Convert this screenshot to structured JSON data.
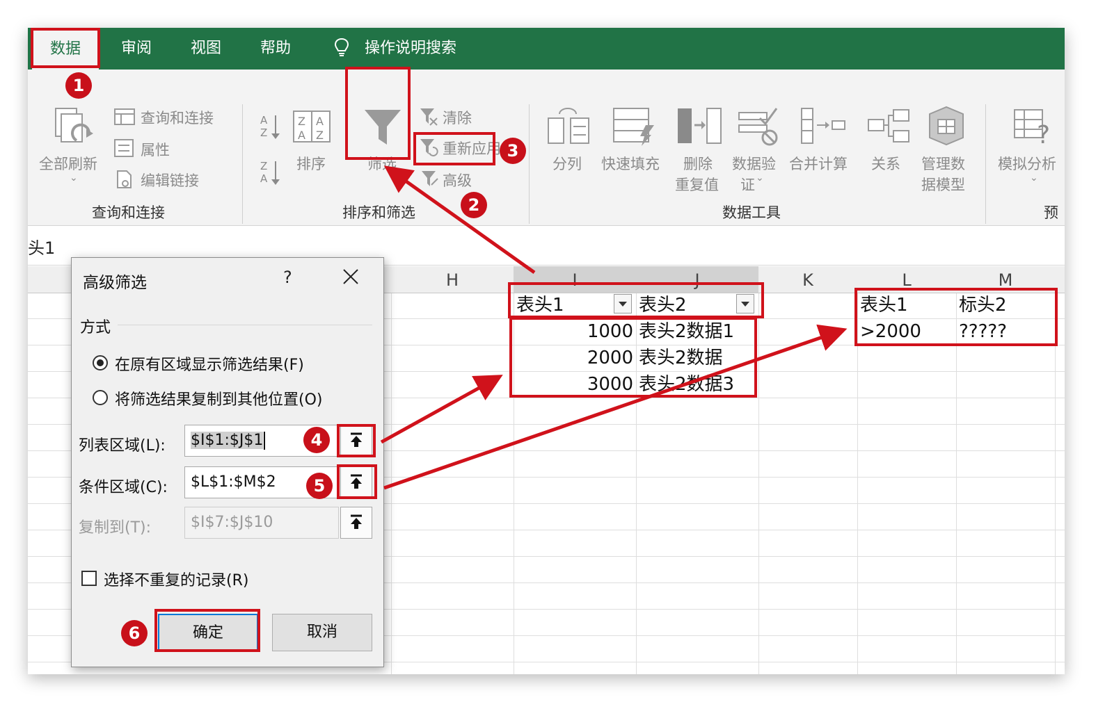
{
  "tabs": {
    "data": "数据",
    "review": "审阅",
    "view": "视图",
    "help": "帮助",
    "search": "操作说明搜索"
  },
  "ribbon": {
    "query_group": {
      "refresh_all": "全部刷新",
      "queries_connections": "查询和连接",
      "properties": "属性",
      "edit_links": "编辑链接",
      "group_label": "查询和连接"
    },
    "sort_group": {
      "sort": "排序",
      "filter": "筛选",
      "clear": "清除",
      "reapply": "重新应用",
      "advanced": "高级",
      "group_label": "排序和筛选"
    },
    "tools_group": {
      "text_to_columns": "分列",
      "flash_fill": "快速填充",
      "remove_dup_1": "删除",
      "remove_dup_2": "重复值",
      "validation_1": "数据验",
      "validation_2": "证",
      "consolidate": "合并计算",
      "relationships": "关系",
      "manage_model_1": "管理数",
      "manage_model_2": "据模型",
      "group_label": "数据工具"
    },
    "forecast_group": {
      "whatif": "模拟分析",
      "group_label_partial": "预"
    }
  },
  "formula_bar": {
    "value": "头1"
  },
  "sheet": {
    "columns": [
      "H",
      "I",
      "J",
      "K",
      "L",
      "M"
    ],
    "list": {
      "header1": "表头1",
      "header2": "表头2",
      "rows": [
        {
          "a": "1000",
          "b": "表头2数据1"
        },
        {
          "a": "2000",
          "b": "表头2数据"
        },
        {
          "a": "3000",
          "b": "表头2数据3"
        }
      ]
    },
    "criteria": {
      "h1": "表头1",
      "h2": "标头2",
      "c1": ">2000",
      "c2": "?????"
    }
  },
  "dialog": {
    "title": "高级筛选",
    "help": "?",
    "mode_label": "方式",
    "option_in_place": "在原有区域显示筛选结果(F)",
    "option_copy": "将筛选结果复制到其他位置(O)",
    "list_range_label": "列表区域(L):",
    "list_range_value": "$I$1:$J$1",
    "criteria_range_label": "条件区域(C):",
    "criteria_range_value": "$L$1:$M$2",
    "copy_to_label": "复制到(T):",
    "copy_to_value": "$I$7:$J$10",
    "unique_label": "选择不重复的记录(R)",
    "ok": "确定",
    "cancel": "取消"
  },
  "annotations": {
    "badges": [
      "1",
      "2",
      "3",
      "4",
      "5",
      "6"
    ],
    "color": "#d0121b"
  },
  "theme": {
    "excel_green": "#217346"
  }
}
